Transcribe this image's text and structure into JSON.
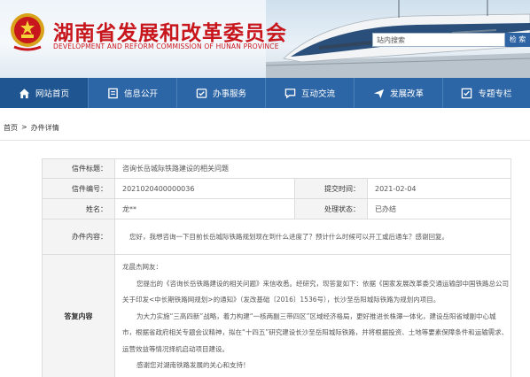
{
  "header": {
    "title": "湖南省发展和改革委员会",
    "subtitle": "DEVELOPMENT AND REFORM COMMISSION OF HUNAN PROVINCE",
    "search_placeholder": "站内搜索",
    "search_button": "检 索"
  },
  "nav": {
    "items": [
      {
        "label": "网站首页",
        "icon": "home-icon"
      },
      {
        "label": "信息公开",
        "icon": "document-icon"
      },
      {
        "label": "办事服务",
        "icon": "service-icon"
      },
      {
        "label": "互动交流",
        "icon": "chat-icon"
      },
      {
        "label": "发展改革",
        "icon": "plane-icon"
      },
      {
        "label": "专题专栏",
        "icon": "checklist-icon"
      }
    ]
  },
  "breadcrumb": {
    "home": "首页",
    "separator": ">",
    "current": "办件详情"
  },
  "detail": {
    "title_label": "信件标题：",
    "title_value": "咨询长岳城际铁路建设的相关问题",
    "number_label": "信件编号：",
    "number_value": "2021020400000036",
    "date_label": "提交时间：",
    "date_value": "2021-02-04",
    "name_label": "姓名：",
    "name_value": "龙**",
    "status_label": "处理状态：",
    "status_value": "已办结",
    "content_label": "办件内容：",
    "content_value": "您好，我想咨询一下目前长岳城际铁路规划现在到什么进度了？预计什么时候可以开工或后通车？感谢回复。",
    "reply_label": "答复内容",
    "reply_lines": [
      "龙晨杰网友：",
      "您提出的《咨询长岳铁路建设的相关问题》来信收悉。经研究，现答复如下：依据《国家发展改革委交通运输部中国铁路总公司",
      "关于印发<中长期铁路网规划>的通知》（发改基础〔2016〕1536号），长沙至岳阳城际铁路为规划内项目。",
      "为大力实施“三高四新”战略，着力构建“一核两副三带四区”区域经济格局，更好推进长株潭一体化，建设岳阳省域副中心城",
      "市，根据省政府相关专题会议精神，拟在“十四五”研究建设长沙至岳阳城际铁路，并将根据投资、土地等要素保障条件和运输需求、",
      "运营效益等情况择机启动项目建设。",
      "感谢您对湖南铁路发展的关心和支持！"
    ]
  },
  "colors": {
    "brand_red": "#c8161d",
    "nav_blue": "#2d66a6",
    "label_bg": "#f4f4f4"
  }
}
